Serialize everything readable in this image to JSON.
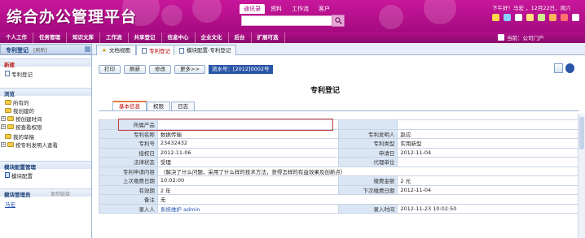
{
  "header": {
    "logo": "综合办公管理平台",
    "top_tabs": [
      "通讯录",
      "资料",
      "工作流",
      "客户"
    ],
    "user_info": "下午好！马宏 ，12月22日，周六"
  },
  "nav": {
    "items": [
      "个人工作",
      "任务管理",
      "知识文库",
      "工作流",
      "共享登记",
      "信息中心",
      "企业文化",
      "后台",
      "扩展可选"
    ],
    "current_position": "当前：公司门户"
  },
  "window_tabs": {
    "sidebar_title": "专利登记",
    "sidebar_title_sub": "[刷新]",
    "tabs": [
      "文档视图",
      "专利登记",
      "模块配置-专利登记"
    ],
    "active_index": 1
  },
  "sidebar": {
    "section_new": "新建",
    "new_items": [
      "专利登记"
    ],
    "section_browse": "浏览",
    "browse_items": [
      "所有的",
      "我创建的",
      "按创建时间",
      "按查看权限",
      "我的草稿",
      "按专利发明人查看"
    ],
    "section_module": "模块配置管理",
    "module_items": [
      "模块配置"
    ],
    "section_admin": "模块管理员",
    "admin_link": "复制链接",
    "admin_name": "马宏"
  },
  "toolbar": {
    "buttons": [
      "打印",
      "刷新",
      "修改",
      "更多>>"
    ],
    "serial": "流水号：[2012]0002号"
  },
  "form": {
    "title": "专利登记",
    "tabs": [
      "基本信息",
      "权限",
      "日志"
    ],
    "rows": [
      [
        {
          "label": "所属产品",
          "value": ""
        },
        {
          "label": "",
          "value": ""
        }
      ],
      [
        {
          "label": "专利名称",
          "value": "数据传输"
        },
        {
          "label": "专利发明人",
          "value": "赵应"
        }
      ],
      [
        {
          "label": "专利号",
          "value": "23432432"
        },
        {
          "label": "专利类型",
          "value": "实用新型"
        }
      ],
      [
        {
          "label": "授权日",
          "value": "2012-11-06"
        },
        {
          "label": "申请日",
          "value": "2012-11-04"
        }
      ],
      [
        {
          "label": "法律状态",
          "value": "受理"
        },
        {
          "label": "代理单位",
          "value": ""
        }
      ],
      [
        {
          "label": "专利申请内容",
          "value": "（解决了什么问题，采用了什么样的技术方法，获得怎样的有益效果及创新点）",
          "span": true
        }
      ],
      [
        {
          "label": "上次缴费日期",
          "value": "10:02:00"
        },
        {
          "label": "缴费金额",
          "value": "2 元"
        }
      ],
      [
        {
          "label": "有效期",
          "value": "2 年"
        },
        {
          "label": "下次缴费日期",
          "value": "2012-11-04"
        }
      ],
      [
        {
          "label": "备注",
          "value": "无",
          "span": true
        }
      ],
      [
        {
          "label": "录入人",
          "value": "系统维护 admin",
          "link": true
        },
        {
          "label": "录入时间",
          "value": "2012-11-23 10:02:50"
        }
      ]
    ]
  },
  "colors": {
    "header_magenta": "#b8118f",
    "nav_magenta": "#9a0c79",
    "panel_blue": "#dbe6f5",
    "highlight_red": "#c83a3a"
  }
}
